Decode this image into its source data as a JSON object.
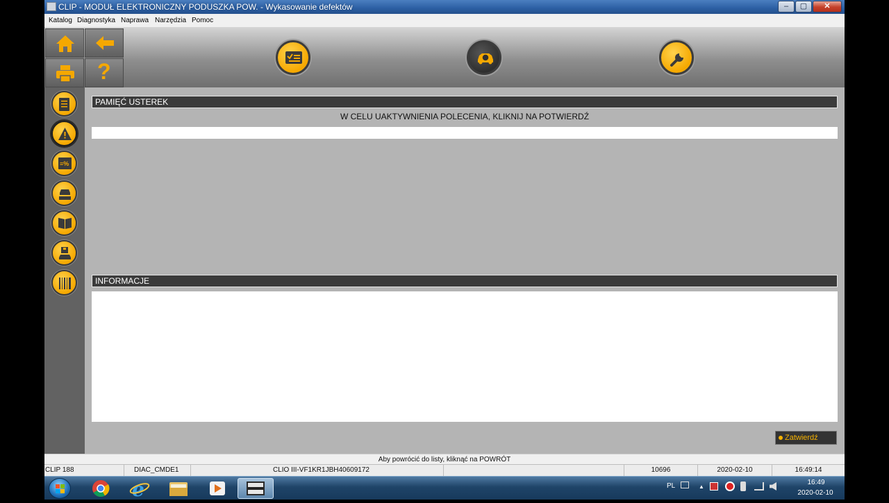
{
  "window": {
    "title": "CLIP - MODUŁ ELEKTRONICZNY PODUSZKA POW. - Wykasowanie defektów",
    "min_label": "–",
    "max_label": "▢",
    "close_label": "✕"
  },
  "menu": [
    "Katalog",
    "Diagnostyka",
    "Naprawa",
    "Narzędzia",
    "Pomoc"
  ],
  "toolbar": {
    "help_label": "?"
  },
  "main": {
    "fault_memory_title": "PAMIĘĆ USTEREK",
    "fault_memory_instruction": "W CELU UAKTYWNIENIA POLECENIA, KLIKNIJ NA POTWIERDŹ",
    "info_title": "INFORMACJE",
    "confirm_label": "Zatwierdź"
  },
  "hint": "Aby powrócić do listy, kliknąć na POWRÓT",
  "status": {
    "app": "CLIP 188",
    "module": "DIAC_CMDE1",
    "vehicle": "CLIO III-VF1KR1JBH40609172",
    "code": "10696",
    "date": "2020-02-10",
    "time": "16:49:14"
  },
  "tray": {
    "lang": "PL",
    "clock_time": "16:49",
    "clock_date": "2020-02-10"
  },
  "colors": {
    "accent": "#f5a800",
    "panel_dark": "#3b3b3b",
    "background": "#b4b4b4"
  }
}
